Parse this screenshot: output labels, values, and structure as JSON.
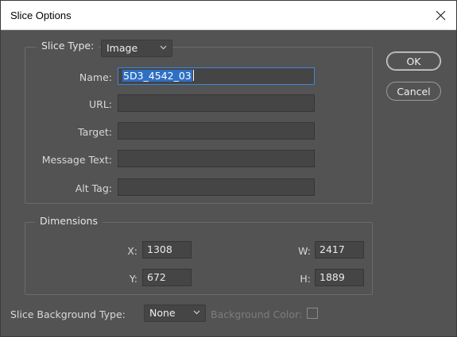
{
  "window": {
    "title": "Slice Options",
    "close_glyph": "close-icon"
  },
  "slice_type": {
    "label": "Slice Type:",
    "value": "Image"
  },
  "fields": {
    "name": {
      "label": "Name:",
      "value": "5D3_4542_03"
    },
    "url": {
      "label": "URL:",
      "value": ""
    },
    "target": {
      "label": "Target:",
      "value": ""
    },
    "message_text": {
      "label": "Message Text:",
      "value": ""
    },
    "alt_tag": {
      "label": "Alt Tag:",
      "value": ""
    }
  },
  "dimensions": {
    "legend": "Dimensions",
    "x": {
      "label": "X:",
      "value": "1308"
    },
    "y": {
      "label": "Y:",
      "value": "672"
    },
    "w": {
      "label": "W:",
      "value": "2417"
    },
    "h": {
      "label": "H:",
      "value": "1889"
    }
  },
  "background": {
    "label": "Slice Background Type:",
    "type_value": "None",
    "color_label": "Background Color:"
  },
  "buttons": {
    "ok": "OK",
    "cancel": "Cancel"
  },
  "colors": {
    "dialog_bg": "#535353",
    "field_bg": "#454545",
    "focus_border": "#3f86d8",
    "selection": "#2f6fc4"
  }
}
